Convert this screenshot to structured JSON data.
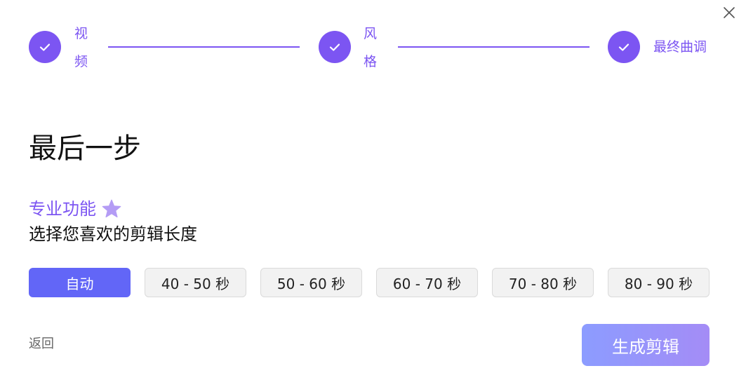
{
  "close": {
    "icon": "close-icon"
  },
  "stepper": {
    "color": "#7c55f2",
    "steps": [
      {
        "label": "视频",
        "icon": "check-icon"
      },
      {
        "label": "风格",
        "icon": "check-icon"
      },
      {
        "label": "最终曲调",
        "icon": "check-icon"
      }
    ]
  },
  "main": {
    "heading": "最后一步",
    "pro_label": "专业功能",
    "pro_icon": "star-icon",
    "subheading": "选择您喜欢的剪辑长度"
  },
  "options": {
    "selected_index": 0,
    "items": [
      "自动",
      "40 - 50 秒",
      "50 - 60 秒",
      "60 - 70 秒",
      "70 - 80 秒",
      "80 - 90 秒"
    ]
  },
  "footer": {
    "back_label": "返回",
    "generate_label": "生成剪辑"
  },
  "colors": {
    "accent": "#7c55f2",
    "selected_option": "#6266f7",
    "generate_gradient_start": "#8c9cff",
    "generate_gradient_end": "#a48cf6"
  }
}
